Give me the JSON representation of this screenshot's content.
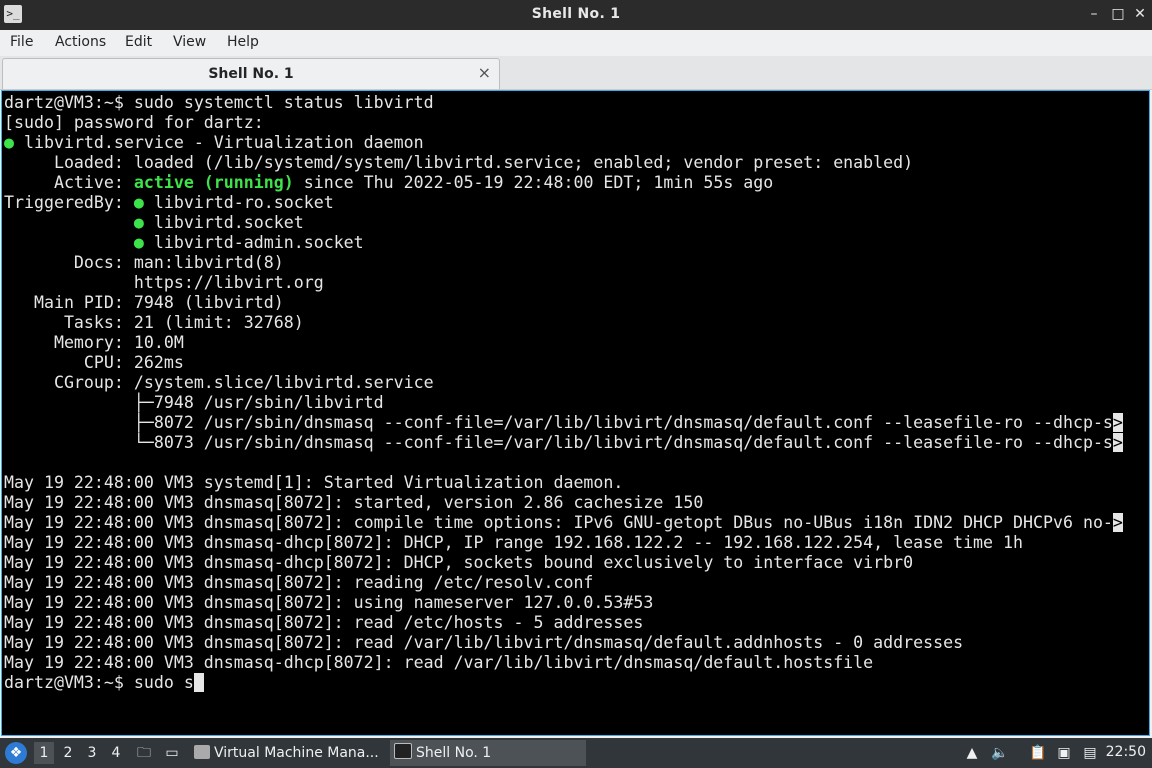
{
  "window": {
    "title": "Shell No. 1",
    "controls": {
      "minimize": "–",
      "maximize": "□",
      "close": "✕"
    }
  },
  "menu": [
    "File",
    "Actions",
    "Edit",
    "View",
    "Help"
  ],
  "tab": {
    "label": "Shell No. 1",
    "close": "×"
  },
  "terminal": {
    "lines": [
      [
        {
          "t": "dartz@VM3:~$ sudo systemctl status libvirtd"
        }
      ],
      [
        {
          "t": "[sudo] password for dartz:"
        }
      ],
      [
        {
          "t": "●",
          "c": "dot"
        },
        {
          "t": " libvirtd.service - Virtualization daemon"
        }
      ],
      [
        {
          "t": "     Loaded: loaded (/lib/systemd/system/libvirtd.service; enabled; vendor preset: enabled)"
        }
      ],
      [
        {
          "t": "     Active: "
        },
        {
          "t": "active (running)",
          "c": "green-bold"
        },
        {
          "t": " since Thu 2022-05-19 22:48:00 EDT; 1min 55s ago"
        }
      ],
      [
        {
          "t": "TriggeredBy: "
        },
        {
          "t": "●",
          "c": "dot"
        },
        {
          "t": " libvirtd-ro.socket"
        }
      ],
      [
        {
          "t": "             "
        },
        {
          "t": "●",
          "c": "dot"
        },
        {
          "t": " libvirtd.socket"
        }
      ],
      [
        {
          "t": "             "
        },
        {
          "t": "●",
          "c": "dot"
        },
        {
          "t": " libvirtd-admin.socket"
        }
      ],
      [
        {
          "t": "       Docs: man:libvirtd(8)"
        }
      ],
      [
        {
          "t": "             https://libvirt.org"
        }
      ],
      [
        {
          "t": "   Main PID: 7948 (libvirtd)"
        }
      ],
      [
        {
          "t": "      Tasks: 21 (limit: 32768)"
        }
      ],
      [
        {
          "t": "     Memory: 10.0M"
        }
      ],
      [
        {
          "t": "        CPU: 262ms"
        }
      ],
      [
        {
          "t": "     CGroup: /system.slice/libvirtd.service"
        }
      ],
      [
        {
          "t": "             ├─7948 /usr/sbin/libvirtd"
        }
      ],
      [
        {
          "t": "             ├─8072 /usr/sbin/dnsmasq --conf-file=/var/lib/libvirt/dnsmasq/default.conf --leasefile-ro --dhcp-s"
        },
        {
          "t": ">",
          "c": "trunc"
        }
      ],
      [
        {
          "t": "             └─8073 /usr/sbin/dnsmasq --conf-file=/var/lib/libvirt/dnsmasq/default.conf --leasefile-ro --dhcp-s"
        },
        {
          "t": ">",
          "c": "trunc"
        }
      ],
      [
        {
          "t": ""
        }
      ],
      [
        {
          "t": "May 19 22:48:00 VM3 systemd[1]: Started Virtualization daemon."
        }
      ],
      [
        {
          "t": "May 19 22:48:00 VM3 dnsmasq[8072]: started, version 2.86 cachesize 150"
        }
      ],
      [
        {
          "t": "May 19 22:48:00 VM3 dnsmasq[8072]: compile time options: IPv6 GNU-getopt DBus no-UBus i18n IDN2 DHCP DHCPv6 no-"
        },
        {
          "t": ">",
          "c": "trunc"
        }
      ],
      [
        {
          "t": "May 19 22:48:00 VM3 dnsmasq-dhcp[8072]: DHCP, IP range 192.168.122.2 -- 192.168.122.254, lease time 1h"
        }
      ],
      [
        {
          "t": "May 19 22:48:00 VM3 dnsmasq-dhcp[8072]: DHCP, sockets bound exclusively to interface virbr0"
        }
      ],
      [
        {
          "t": "May 19 22:48:00 VM3 dnsmasq[8072]: reading /etc/resolv.conf"
        }
      ],
      [
        {
          "t": "May 19 22:48:00 VM3 dnsmasq[8072]: using nameserver 127.0.0.53#53"
        }
      ],
      [
        {
          "t": "May 19 22:48:00 VM3 dnsmasq[8072]: read /etc/hosts - 5 addresses"
        }
      ],
      [
        {
          "t": "May 19 22:48:00 VM3 dnsmasq[8072]: read /var/lib/libvirt/dnsmasq/default.addnhosts - 0 addresses"
        }
      ],
      [
        {
          "t": "May 19 22:48:00 VM3 dnsmasq-dhcp[8072]: read /var/lib/libvirt/dnsmasq/default.hostsfile"
        }
      ],
      [
        {
          "t": "dartz@VM3:~$ sudo s"
        },
        {
          "cursor": true
        }
      ]
    ]
  },
  "taskbar": {
    "desktops": [
      "1",
      "2",
      "3",
      "4"
    ],
    "tasks": [
      {
        "label": "Virtual Machine Mana...",
        "icon": "virt-manager-icon"
      },
      {
        "label": "Shell No. 1",
        "icon": "terminal-icon"
      }
    ],
    "clock": "22:50"
  }
}
